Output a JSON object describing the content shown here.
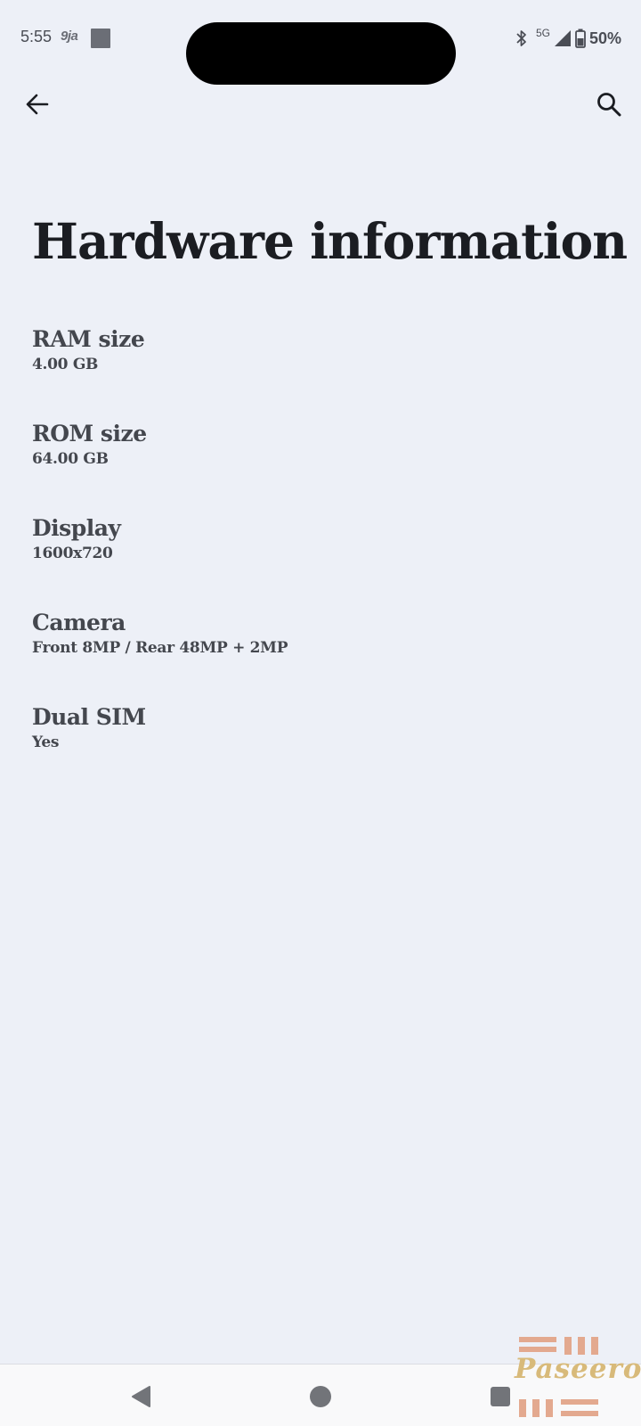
{
  "status_bar": {
    "time": "5:55",
    "app_indicator": "9ja",
    "network": "5G",
    "battery": "50%",
    "icons": [
      "bluetooth-icon",
      "signal-icon",
      "battery-icon"
    ]
  },
  "app_bar": {
    "back_icon": "arrow-left-icon",
    "search_icon": "search-icon"
  },
  "page": {
    "title": "Hardware information"
  },
  "items": [
    {
      "label": "RAM size",
      "value": "4.00 GB"
    },
    {
      "label": "ROM size",
      "value": "64.00 GB"
    },
    {
      "label": "Display",
      "value": "1600x720"
    },
    {
      "label": "Camera",
      "value": "Front 8MP / Rear 48MP + 2MP"
    },
    {
      "label": "Dual SIM",
      "value": "Yes"
    }
  ],
  "nav_bar": {
    "buttons": [
      "back-triangle-icon",
      "home-circle-icon",
      "recents-square-icon"
    ]
  },
  "watermark": {
    "text": "Paseero"
  },
  "colors": {
    "background": "#edf0f7",
    "title": "#1b1d22",
    "text": "#44474e",
    "watermark": "#d8ba7a",
    "watermark_bars": "#e3a98f"
  }
}
